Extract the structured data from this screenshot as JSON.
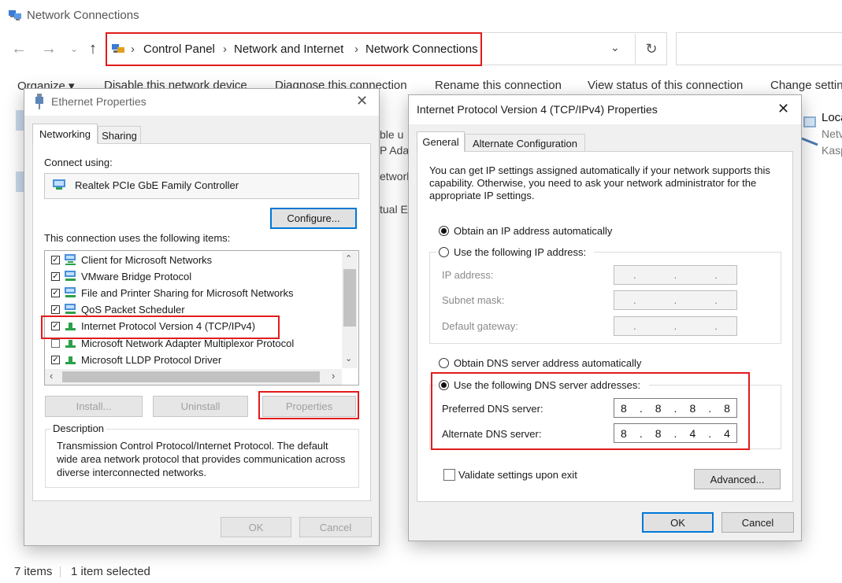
{
  "window": {
    "title": "Network Connections",
    "breadcrumbs": [
      "Control Panel",
      "Network and Internet",
      "Network Connections"
    ],
    "commands": [
      "Organize ▾",
      "Disable this network device",
      "Diagnose this connection",
      "Rename this connection",
      "View status of this connection",
      "Change settin"
    ],
    "status": {
      "items": "7 items",
      "selected": "1 item selected"
    },
    "background_fragments": {
      "mid1": "ble u",
      "mid2": "P Ada",
      "mid3": "etwork",
      "mid4": "tual E",
      "right1": "Loca",
      "right2": "Netv",
      "right3": "Kasp"
    }
  },
  "ethernet": {
    "title": "Ethernet Properties",
    "tabs": [
      "Networking",
      "Sharing"
    ],
    "connect_using_label": "Connect using:",
    "adapter": "Realtek PCIe GbE Family Controller",
    "configure_label": "Configure...",
    "items_label": "This connection uses the following items:",
    "items": [
      {
        "label": "Client for Microsoft Networks",
        "checked": true
      },
      {
        "label": "VMware Bridge Protocol",
        "checked": true
      },
      {
        "label": "File and Printer Sharing for Microsoft Networks",
        "checked": true
      },
      {
        "label": "QoS Packet Scheduler",
        "checked": true
      },
      {
        "label": "Internet Protocol Version 4 (TCP/IPv4)",
        "checked": true
      },
      {
        "label": "Microsoft Network Adapter Multiplexor Protocol",
        "checked": false
      },
      {
        "label": "Microsoft LLDP Protocol Driver",
        "checked": true
      }
    ],
    "install_label": "Install...",
    "uninstall_label": "Uninstall",
    "properties_label": "Properties",
    "description_label": "Description",
    "description_text": "Transmission Control Protocol/Internet Protocol. The default wide area network protocol that provides communication across diverse interconnected networks.",
    "ok_label": "OK",
    "cancel_label": "Cancel"
  },
  "ipv4": {
    "title": "Internet Protocol Version 4 (TCP/IPv4) Properties",
    "tabs": [
      "General",
      "Alternate Configuration"
    ],
    "intro": "You can get IP settings assigned automatically if your network supports this capability. Otherwise, you need to ask your network administrator for the appropriate IP settings.",
    "obtain_ip_auto": "Obtain an IP address automatically",
    "use_following_ip": "Use the following IP address:",
    "ip_address_label": "IP address:",
    "subnet_label": "Subnet mask:",
    "gateway_label": "Default gateway:",
    "obtain_dns_auto": "Obtain DNS server address automatically",
    "use_following_dns": "Use the following DNS server addresses:",
    "preferred_dns_label": "Preferred DNS server:",
    "preferred_dns": [
      "8",
      "8",
      "8",
      "8"
    ],
    "alternate_dns_label": "Alternate DNS server:",
    "alternate_dns": [
      "8",
      "8",
      "4",
      "4"
    ],
    "validate_label": "Validate settings upon exit",
    "advanced_label": "Advanced...",
    "ok_label": "OK",
    "cancel_label": "Cancel"
  },
  "colors": {
    "highlight_red": "#e21b1b",
    "accent_blue": "#0078d7"
  }
}
